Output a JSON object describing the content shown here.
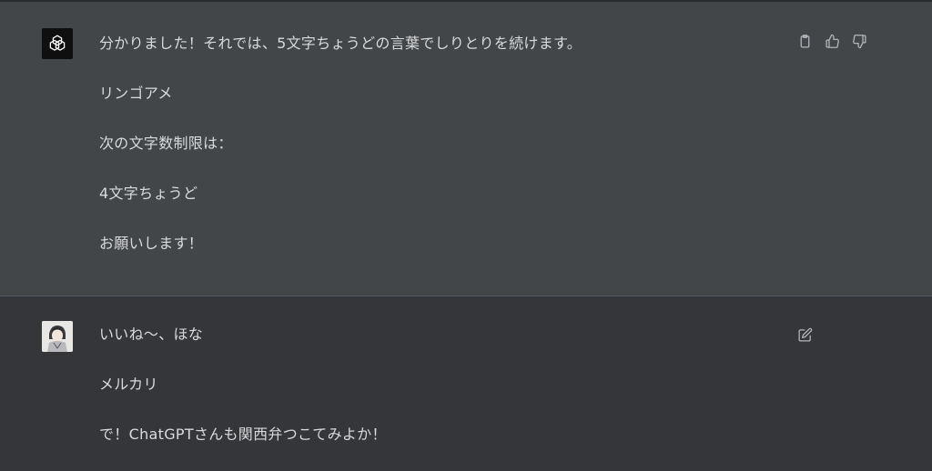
{
  "conversation": {
    "assistant_message": {
      "avatar_icon": "openai-logo-icon",
      "paragraphs": [
        "分かりました！それでは、5文字ちょうどの言葉でしりとりを続けます。",
        "リンゴアメ",
        "次の文字数制限は：",
        "4文字ちょうど",
        "お願いします！"
      ],
      "actions": [
        "copy-icon",
        "thumbs-up-icon",
        "thumbs-down-icon"
      ]
    },
    "user_message": {
      "avatar_icon": "user-avatar",
      "paragraphs": [
        "いいね〜、ほな",
        "メルカリ",
        "で！ChatGPTさんも関西弁つこてみよか！"
      ],
      "actions": [
        "edit-icon"
      ]
    }
  },
  "colors": {
    "assistant_bg": "#434649",
    "user_bg": "#343639",
    "text": "#d9dadc",
    "icon": "#b4b6bb"
  }
}
